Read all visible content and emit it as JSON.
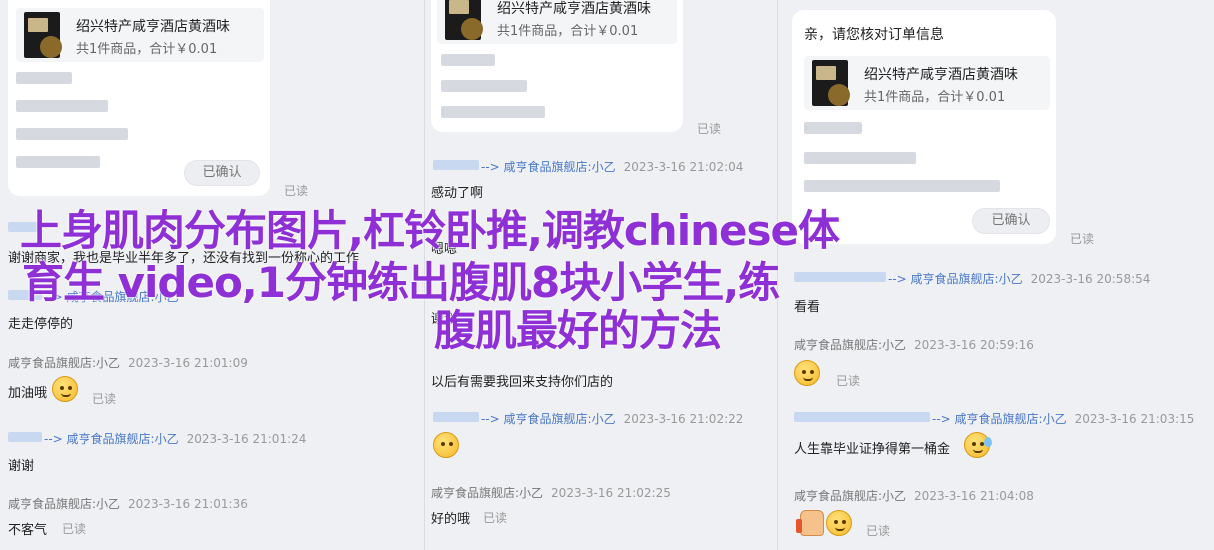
{
  "product": {
    "title": "绍兴特产咸亨酒店黄酒味",
    "subtitle": "共1件商品，合计￥0.01"
  },
  "left": {
    "confirm_label": "已确认",
    "read": "已读",
    "messages": [
      {
        "text": "谢谢商家，我也是毕业半年多了，还没有找到一份称心的工作"
      },
      {
        "shop": "--> 咸亨食品旗舰店:小乙",
        "time": ""
      },
      {
        "text": "走走停停的"
      },
      {
        "shop": "咸亨食品旗舰店:小乙",
        "time": "2023-3-16 21:01:09"
      },
      {
        "text": "加油哦"
      },
      {
        "shop": "--> 咸亨食品旗舰店:小乙",
        "time": "2023-3-16 21:01:24"
      },
      {
        "text": "谢谢"
      },
      {
        "shop": "咸亨食品旗舰店:小乙",
        "time": "2023-3-16 21:01:36"
      },
      {
        "text": "不客气"
      }
    ]
  },
  "mid": {
    "read": "已读",
    "messages": [
      {
        "shop": "--> 咸亨食品旗舰店:小乙",
        "time": "2023-3-16 21:02:04"
      },
      {
        "text": "感动了啊"
      },
      {
        "text": "嗯嗯"
      },
      {
        "text": "谢谢"
      },
      {
        "text": "以后有需要我回来支持你们店的"
      },
      {
        "shop": "--> 咸亨食品旗舰店:小乙",
        "time": "2023-3-16 21:02:22"
      },
      {
        "shop": "咸亨食品旗舰店:小乙",
        "time": "2023-3-16 21:02:25"
      },
      {
        "text": "好的哦"
      }
    ]
  },
  "right": {
    "greeting": "亲，请您核对订单信息",
    "confirm_label": "已确认",
    "read": "已读",
    "messages": [
      {
        "shop": "--> 咸亨食品旗舰店:小乙",
        "time": "2023-3-16 20:58:54"
      },
      {
        "text": "看看"
      },
      {
        "shop": "咸亨食品旗舰店:小乙",
        "time": "2023-3-16 20:59:16"
      },
      {
        "shop": "--> 咸亨食品旗舰店:小乙",
        "time": "2023-3-16 21:03:15"
      },
      {
        "text": "人生靠毕业证挣得第一桶金"
      },
      {
        "shop": "咸亨食品旗舰店:小乙",
        "time": "2023-3-16 21:04:08"
      }
    ]
  },
  "overlay": {
    "line1": "上身肌肉分布图片,杠铃卧推,调教chinese体",
    "line2": "育生 video,1分钟练出腹肌8块小学生,练",
    "line3": "腹肌最好的方法"
  },
  "colors": {
    "link_blue": "#4a78c9",
    "overlay_purple": "#8f2fd6",
    "background": "#eef0f4"
  }
}
